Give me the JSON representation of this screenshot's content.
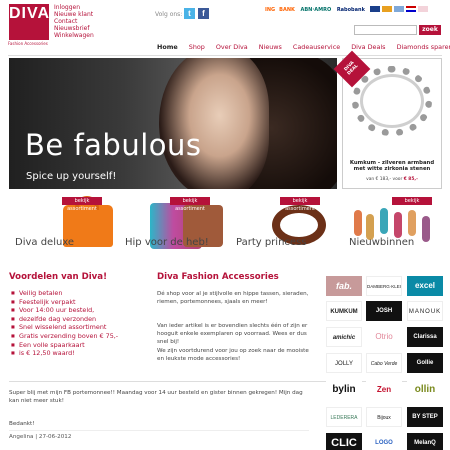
{
  "header": {
    "logo_text": "DIVA",
    "logo_subtitle": "Fashion Accessories",
    "top_links": [
      "Inloggen",
      "Nieuwe klant",
      "Contact",
      "Nieuwsbrief",
      "Winkelwagen"
    ],
    "follow_label": "Volg ons:",
    "twitter_glyph": "t",
    "facebook_glyph": "f",
    "payment_banks": [
      "ING",
      "BANK",
      "ABN·AMRO",
      "Rabobank"
    ],
    "search_placeholder": "",
    "search_button": "zoek"
  },
  "nav": {
    "items": [
      "Home",
      "Shop",
      "Over Diva",
      "Nieuws",
      "Cadeauservice",
      "Diva Deals",
      "Diamonds sparen"
    ],
    "active": "Home"
  },
  "hero": {
    "title": "Be fabulous",
    "subtitle": "Spice up yourself!"
  },
  "promo": {
    "tag": "DIVA DEAL",
    "title": "Kumkum - zilveren armband met witte zirkonia stenen",
    "price_prefix": "van € 183,- voor",
    "price_value": "€ 85,-"
  },
  "categories": [
    {
      "tag": "bekijk assortiment",
      "label": "Diva deluxe"
    },
    {
      "tag": "bekijk assortiment",
      "label": "Hip voor de heb!"
    },
    {
      "tag": "bekijk assortiment",
      "label": "Party princess"
    },
    {
      "tag": "bekijk assortiment",
      "label": "Nieuwbinnen"
    }
  ],
  "voordelen": {
    "title": "Voordelen van Diva!",
    "items": [
      "Veilig betalen",
      "Feestelijk verpakt",
      "Voor 14:00 uur besteld,",
      "dezelfde dag verzonden",
      "Snel wisselend assortiment",
      "Gratis verzending boven € 75,-",
      "Een volle spaarkaart",
      "is € 12,50 waard!"
    ]
  },
  "fashion": {
    "title": "Diva Fashion Accessories",
    "para1": "Dé shop voor al je stijlvolle en hippe tassen, sieraden, riemen, portemonnees, sjaals en meer!",
    "para2": "Van ieder artikel is er bovendien slechts één of zijn er hooguit enkele exemplaren op voorraad. Wees er dus snel bij!",
    "para3": "We zijn voortdurend voor jou op zoek naar de mooiste en leukste mode accessories!"
  },
  "review": {
    "text": "Super blij met mijn FB portemonnee!! Maandag voor 14 uur besteld en gister binnen gekregen! Mijn dag kan niet meer stuk!",
    "thanks": "Bedankt!",
    "author": "Angelina | 27-06-2012"
  },
  "brands": [
    "fab.",
    "DAMBERG·KLEIN",
    "excel",
    "KUMKUM",
    "JOSH",
    "MANOUK",
    "amichic",
    "Otrio",
    "Clarissa",
    "JOLLY",
    "Cabo Verde",
    "Gollie",
    "bylin",
    "Zen",
    "ollin",
    "LEDERERA",
    "Bijoux",
    "BY STEP",
    "CLIC",
    "LOGO",
    "MelanQ"
  ],
  "colors": {
    "brand": "#b5123a"
  }
}
